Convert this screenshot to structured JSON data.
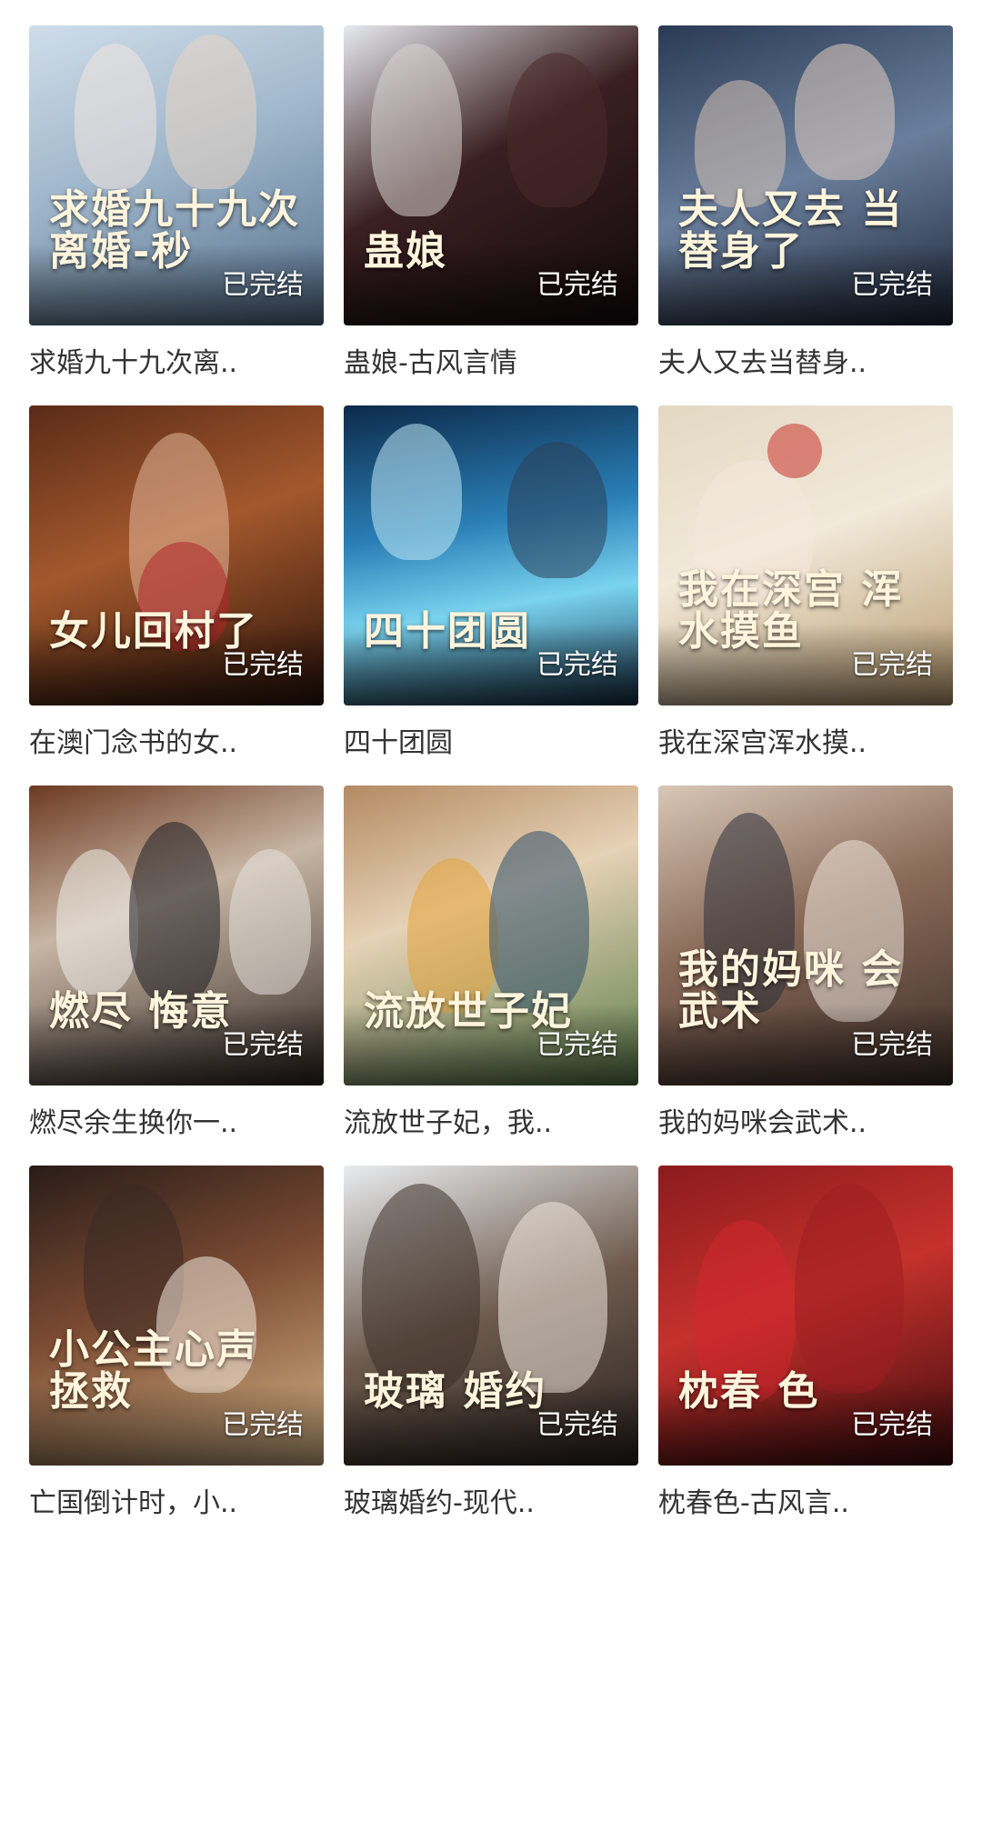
{
  "items": [
    {
      "caption": "求婚九十九次离..",
      "art_title": "求婚九十九次 离婚-秒",
      "badge": "已完结",
      "theme": "p1",
      "accent": "#9fb6ca"
    },
    {
      "caption": "蛊娘-古风言情",
      "art_title": "蛊娘",
      "badge": "已完结",
      "theme": "p2",
      "accent": "#3a1f22"
    },
    {
      "caption": "夫人又去当替身..",
      "art_title": "夫人又去 当替身了",
      "badge": "已完结",
      "theme": "p3",
      "accent": "#6a7f9d"
    },
    {
      "caption": "在澳门念书的女..",
      "art_title": "女儿回村了",
      "badge": "已完结",
      "theme": "p4",
      "accent": "#a3582c"
    },
    {
      "caption": "四十团圆",
      "art_title": "四十团圆",
      "badge": "已完结",
      "theme": "p5",
      "accent": "#2a7fb6"
    },
    {
      "caption": "我在深宫浑水摸..",
      "art_title": "我在深宫 浑水摸鱼",
      "badge": "已完结",
      "theme": "p6",
      "accent": "#b99a6e"
    },
    {
      "caption": "燃尽余生换你一..",
      "art_title": "燃尽 悔意",
      "badge": "已完结",
      "theme": "p7",
      "accent": "#c8b6a4"
    },
    {
      "caption": "流放世子妃，我..",
      "art_title": "流放世子妃",
      "badge": "已完结",
      "theme": "p8",
      "accent": "#5c7d4a"
    },
    {
      "caption": "我的妈咪会武术..",
      "art_title": "我的妈咪 会武术",
      "badge": "已完结",
      "theme": "p9",
      "accent": "#8a6a58"
    },
    {
      "caption": "亡国倒计时，小..",
      "art_title": "小公主心声 拯救",
      "badge": "已完结",
      "theme": "p10",
      "accent": "#d8b78a"
    },
    {
      "caption": "玻璃婚约-现代..",
      "art_title": "玻璃 婚约",
      "badge": "已完结",
      "theme": "p11",
      "accent": "#6d5a4c"
    },
    {
      "caption": "枕春色-古风言..",
      "art_title": "枕春 色",
      "badge": "已完结",
      "theme": "p12",
      "accent": "#c5312c"
    }
  ]
}
